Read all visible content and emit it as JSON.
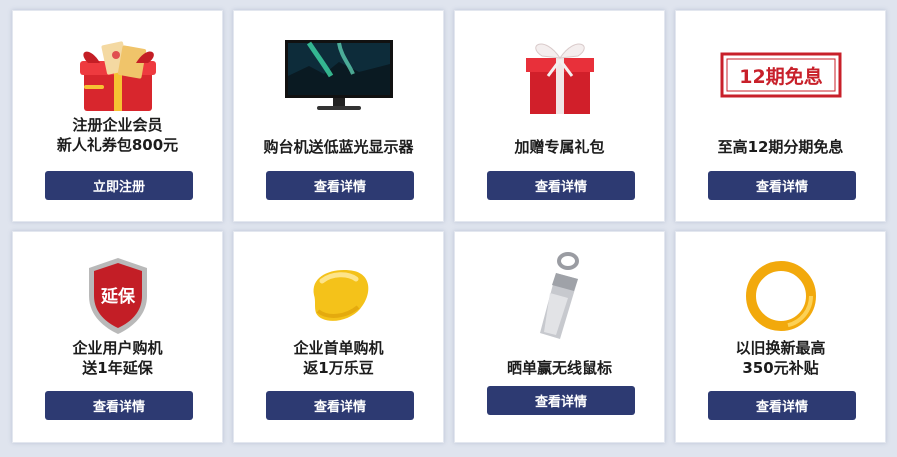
{
  "cards": [
    {
      "line1": "注册企业会员",
      "line2": "新人礼券包800元",
      "button": "立即注册",
      "icon": "red-gift-box-with-coupons-icon"
    },
    {
      "line1": "购台机送低蓝光显示器",
      "button": "查看详情",
      "icon": "monitor-icon"
    },
    {
      "line1": "加赠专属礼包",
      "button": "查看详情",
      "icon": "gift-box-icon"
    },
    {
      "line1": "至高12期分期免息",
      "button": "查看详情",
      "icon": "interest-free-stamp-icon",
      "stamp_text": "12期免息"
    },
    {
      "line1": "企业用户购机",
      "line2": "送1年延保",
      "button": "查看详情",
      "icon": "shield-icon",
      "shield_text": "延保"
    },
    {
      "line1": "企业首单购机",
      "line2": "返1万乐豆",
      "button": "查看详情",
      "icon": "bean-icon"
    },
    {
      "line1": "晒单赢无线鼠标",
      "button": "查看详情",
      "icon": "usb-drive-icon"
    },
    {
      "line1": "以旧换新最高",
      "line2": "350元补贴",
      "button": "查看详情",
      "icon": "gold-ring-icon"
    }
  ],
  "colors": {
    "button_bg": "#2d3a72",
    "accent_red": "#c8202a",
    "gold": "#f2a90c"
  }
}
